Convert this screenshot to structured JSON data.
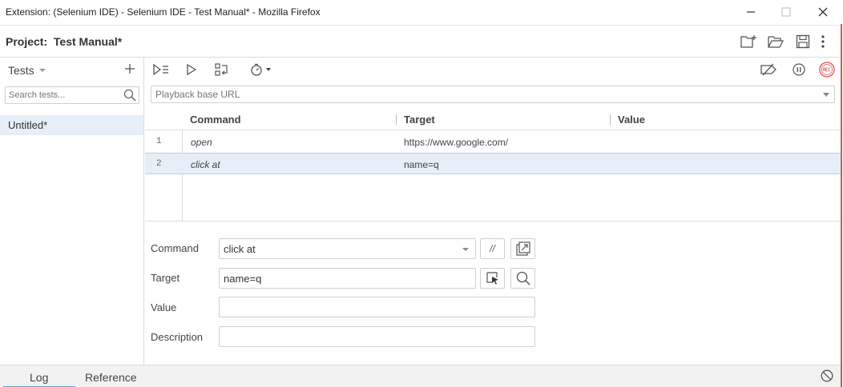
{
  "window": {
    "title": "Extension: (Selenium IDE) - Selenium IDE - Test Manual* - Mozilla Firefox"
  },
  "project": {
    "label": "Project:",
    "name": "Test Manual*"
  },
  "sidebar": {
    "header": "Tests",
    "search_placeholder": "Search tests...",
    "tests": [
      {
        "name": "Untitled*"
      }
    ]
  },
  "toolbar": {
    "url_placeholder": "Playback base URL"
  },
  "table": {
    "headers": {
      "command": "Command",
      "target": "Target",
      "value": "Value"
    },
    "rows": [
      {
        "num": "1",
        "command": "open",
        "target": "https://www.google.com/",
        "value": ""
      },
      {
        "num": "2",
        "command": "click at",
        "target": "name=q",
        "value": ""
      }
    ]
  },
  "editor": {
    "command_label": "Command",
    "command_value": "click at",
    "target_label": "Target",
    "target_value": "name=q",
    "value_label": "Value",
    "value_value": "",
    "description_label": "Description",
    "description_value": "",
    "comment_button": "//"
  },
  "bottom_tabs": {
    "log": "Log",
    "reference": "Reference"
  },
  "colors": {
    "selection": "#e6eef7",
    "accent": "#5fa8d3",
    "record": "#d9534f"
  }
}
